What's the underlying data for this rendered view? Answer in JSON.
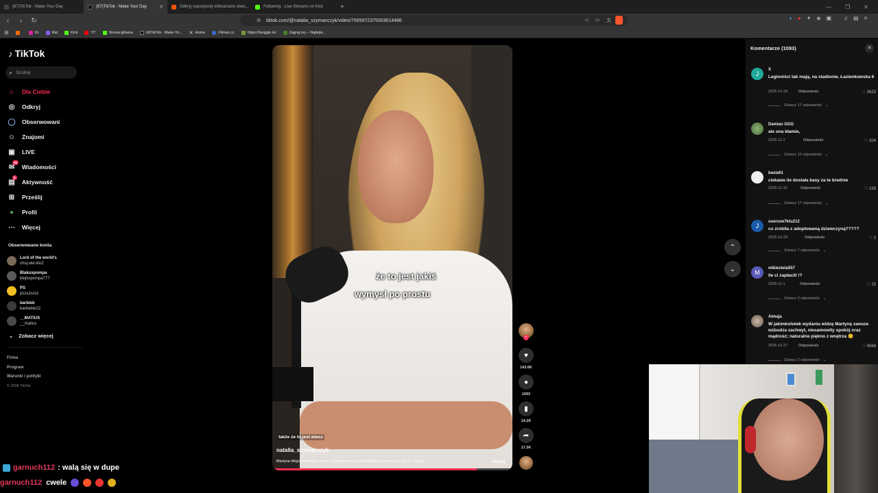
{
  "browser": {
    "tabs": [
      {
        "title": "(67)TikTok - Make Your Day",
        "color": "#2a2a2a",
        "active": false
      },
      {
        "title": "(67)TikTok - Make Your Day",
        "color": "#2a2a2a",
        "active": true
      },
      {
        "title": "Odkryj najczęściej odtwarzane utwo...",
        "color": "#ff5500",
        "active": false
      },
      {
        "title": "Following - Live Streams on Kick",
        "color": "#53fc18",
        "active": false
      }
    ],
    "new_tab": "+",
    "url": "tiktok.com/@natalia_szymanczyk/video/7565972375003614486",
    "bookmarks": [
      {
        "label": "",
        "color": "#ff6a00"
      },
      {
        "label": "IG",
        "color": "#d6249f"
      },
      {
        "label": "Rat",
        "color": "#8a5cf6"
      },
      {
        "label": "Kick",
        "color": "#53fc18"
      },
      {
        "label": "YT",
        "color": "#ff0000"
      },
      {
        "label": "Strona główna",
        "color": "#53fc18"
      },
      {
        "label": "(4)TikTok - Make Yo...",
        "color": "#111111"
      },
      {
        "label": "Home",
        "color": "#111111"
      },
      {
        "label": "Filman.cc",
        "color": "#3b6fd6"
      },
      {
        "label": "https://tanggle.io/",
        "color": "#7a9a3a"
      },
      {
        "label": "Zagraj.my – Najleps...",
        "color": "#4a7a2a"
      }
    ]
  },
  "sidebar": {
    "logo": "TikTok",
    "search_placeholder": "Szukaj",
    "nav": [
      {
        "label": "Dla Ciebie",
        "icon": "home-icon",
        "glyph": "⌂",
        "active": true
      },
      {
        "label": "Odkryj",
        "icon": "compass-icon",
        "glyph": "◎",
        "active": false
      },
      {
        "label": "Obserwowani",
        "icon": "following-icon",
        "glyph": "◯",
        "active": false
      },
      {
        "label": "Znajomi",
        "icon": "friends-icon",
        "glyph": "☺",
        "active": false
      },
      {
        "label": "LIVE",
        "icon": "live-icon",
        "glyph": "▣",
        "active": false
      },
      {
        "label": "Wiadomości",
        "icon": "messages-icon",
        "glyph": "✉",
        "active": false,
        "badge": "46"
      },
      {
        "label": "Aktywność",
        "icon": "activity-icon",
        "glyph": "▤",
        "active": false,
        "badge": "8"
      },
      {
        "label": "Prześlij",
        "icon": "upload-icon",
        "glyph": "⊞",
        "active": false
      },
      {
        "label": "Profil",
        "icon": "profile-icon",
        "glyph": "●",
        "active": false
      },
      {
        "label": "Więcej",
        "icon": "more-icon",
        "glyph": "⋯",
        "active": false
      }
    ],
    "following_title": "Obserwowane konta",
    "following": [
      {
        "name": "Lord of the world's",
        "user": "chuj.wie.kto2",
        "color": "#7a6a5a"
      },
      {
        "name": "Blakuxpompa",
        "user": "blejkxpompa777",
        "color": "#5a5a5a"
      },
      {
        "name": "PS",
        "user": "pszszszsz",
        "color": "#f0c020"
      },
      {
        "name": "barbieb",
        "user": "barbebie22",
        "color": "#3a3a3a"
      },
      {
        "name": "__MATIUS",
        "user": "__matius",
        "color": "#4a4a4a"
      }
    ],
    "see_more": "Zobacz więcej",
    "footer": [
      "Firma",
      "Program",
      "Warunki i polityki"
    ],
    "copyright": "© 2026 TikTok"
  },
  "video": {
    "subtitle_line1": "że to jest jakiś",
    "subtitle_line2": "wymysł po prostu",
    "small_caption": "także że to jest wiesz",
    "author": "natalia_szymanczyk",
    "description": "Martyna Wojciechowska u mnie. Zapraszam na kanał Natalia Szymańczyk na YT i Spoti... ",
    "more": "więcej",
    "progress": 0.85,
    "likes": "143.6K",
    "comments": "1093",
    "saves": "14.2K",
    "shares": "17.3K"
  },
  "comments_panel": {
    "title": "Komentarze (1093)",
    "reply_label": "Odpowiedz",
    "items": [
      {
        "avatar": "J",
        "color": "#20a89a",
        "user": "X",
        "text": "Legioniści tak mają, na stadionie, Łazienkowska 6",
        "date": "2025-10-28",
        "likes": "3623",
        "replies": "Zobacz 17 odpowiedzi"
      },
      {
        "avatar": "",
        "color": "#5a7a4a",
        "user": "Damian GGG",
        "text": "ale ona kłamie,",
        "date": "2025-11-2",
        "likes": "204",
        "replies": "Zobacz 12 odpowiedzi"
      },
      {
        "avatar": "",
        "color": "#e8e8e8",
        "user": "basia61",
        "text": "ciekawe ile dostała kasy za te brednie",
        "date": "2025-11-10",
        "likes": "158",
        "replies": "Zobacz 17 odpowiedzi"
      },
      {
        "avatar": "J",
        "color": "#1a5aa8",
        "user": "useruoe7ktu212",
        "text": "co zrobiła z adoptowaną dziewczyną?????",
        "date": "2025-10-28",
        "likes": "2",
        "replies": "Zobacz 7 odpowiedzi"
      },
      {
        "avatar": "M",
        "color": "#5a5ab8",
        "user": "mikiestela557",
        "text": "ile ci zapłacili !?",
        "date": "2025-11-1",
        "likes": "15",
        "replies": "Zobacz 3 odpowiedzi"
      },
      {
        "avatar": "",
        "color": "#8a7a6a",
        "user": "Almaja",
        "text": "W jakimkolwiek wydaniu widzę Martynę zawsze wzbudza zachwyt, niesamowity spokój oraz mądrość; naturalne piękno z wnętrza 😊",
        "date": "2025-10-27",
        "likes": "4568",
        "replies": "Zobacz 3 odpowiedzi"
      }
    ]
  },
  "chat": {
    "line1_name": "garnuch112",
    "line1_text": ": walą się w dupe",
    "line2_name": "garnuch112",
    "line2_text": "cwele"
  }
}
